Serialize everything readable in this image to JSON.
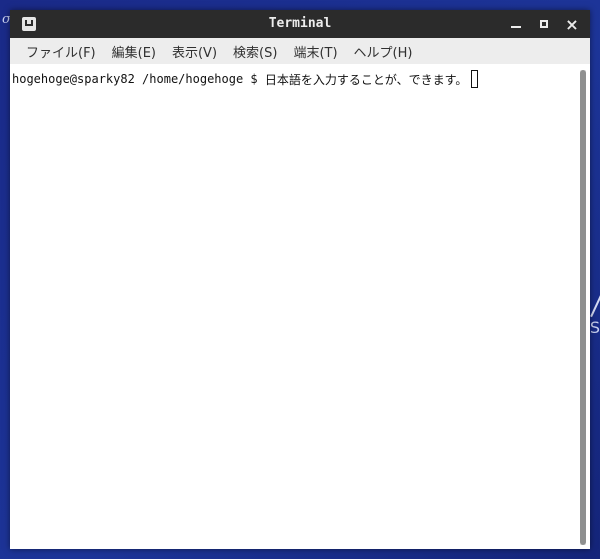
{
  "desktop": {
    "left_glyph": "σ",
    "right_glyph": "S"
  },
  "window": {
    "title": "Terminal",
    "controls": {
      "minimize": "minimize",
      "maximize": "maximize",
      "close": "×"
    }
  },
  "menubar": {
    "items": [
      {
        "label": "ファイル(F)"
      },
      {
        "label": "編集(E)"
      },
      {
        "label": "表示(V)"
      },
      {
        "label": "検索(S)"
      },
      {
        "label": "端末(T)"
      },
      {
        "label": "ヘルプ(H)"
      }
    ]
  },
  "terminal": {
    "prompt": "hogehoge@sparky82 /home/hogehoge $ ",
    "input": "日本語を入力することが、できます。"
  },
  "colors": {
    "titlebar": "#2b2b2b",
    "menubar": "#ededed",
    "desktop": "#1c2f8f",
    "scroll_thumb": "#8f9090"
  }
}
